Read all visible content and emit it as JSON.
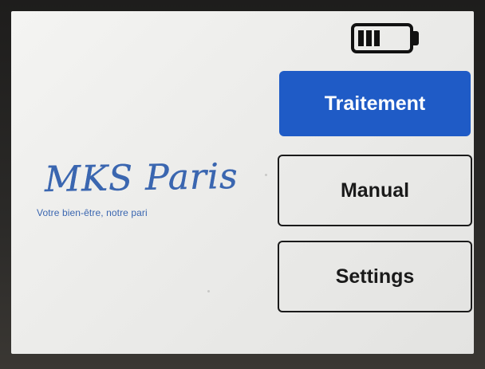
{
  "battery": {
    "icon": "battery-icon",
    "level_bars": 3,
    "max_bars": 4
  },
  "logo": {
    "brand": "MKS Paris",
    "tagline": "Votre bien-être, notre pari",
    "color": "#3a66b0"
  },
  "menu": {
    "treatment_label": "Traitement",
    "manual_label": "Manual",
    "settings_label": "Settings",
    "accent_color": "#1f5bc6"
  }
}
